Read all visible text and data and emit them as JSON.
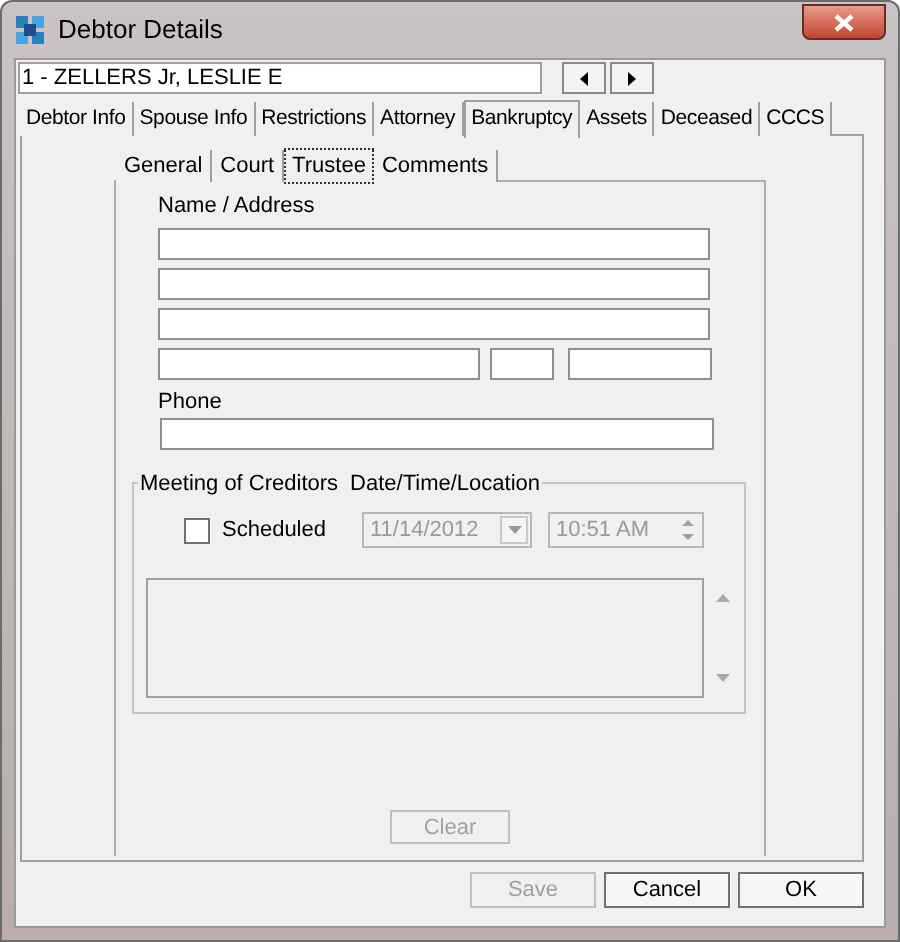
{
  "window": {
    "title": "Debtor Details"
  },
  "record": {
    "value": "1 - ZELLERS Jr, LESLIE E"
  },
  "tabs": [
    {
      "label": "Debtor Info",
      "selected": false
    },
    {
      "label": "Spouse Info",
      "selected": false
    },
    {
      "label": "Restrictions",
      "selected": false
    },
    {
      "label": "Attorney",
      "selected": false
    },
    {
      "label": "Bankruptcy",
      "selected": true
    },
    {
      "label": "Assets",
      "selected": false
    },
    {
      "label": "Deceased",
      "selected": false
    },
    {
      "label": "CCCS",
      "selected": false
    }
  ],
  "sub_tabs": [
    {
      "label": "General",
      "selected": false
    },
    {
      "label": "Court",
      "selected": false
    },
    {
      "label": "Trustee",
      "selected": true
    },
    {
      "label": "Comments",
      "selected": false
    }
  ],
  "trustee": {
    "name_address_label": "Name / Address",
    "phone_label": "Phone"
  },
  "meeting": {
    "title": "Meeting of Creditors",
    "subtitle": "Date/Time/Location",
    "scheduled": {
      "label": "Scheduled",
      "checked": false
    },
    "date": {
      "value": "11/14/2012",
      "disabled": true
    },
    "time": {
      "value": "10:51 AM",
      "disabled": true
    }
  },
  "clear_button": {
    "label": "Clear",
    "disabled": true
  },
  "buttons": [
    {
      "label": "Save",
      "disabled": true
    },
    {
      "label": "Cancel",
      "disabled": false
    },
    {
      "label": "OK",
      "disabled": false
    }
  ]
}
